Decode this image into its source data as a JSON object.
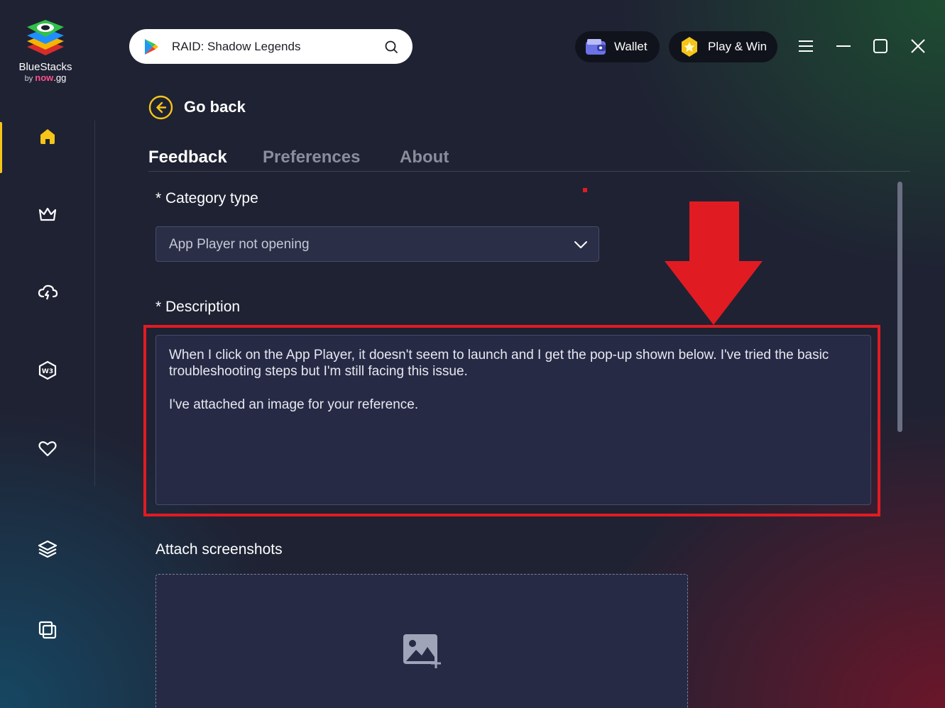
{
  "app": {
    "logo_name": "BlueStacks",
    "logo_by": "by",
    "logo_now": "now",
    "logo_gg": ".gg"
  },
  "search": {
    "value": "RAID: Shadow Legends",
    "icon": "search-icon",
    "store_icon": "google-play-icon"
  },
  "topbar": {
    "wallet_label": "Wallet",
    "playwin_label": "Play & Win"
  },
  "sidebar": {
    "items": [
      {
        "icon": "home-icon",
        "active": true
      },
      {
        "icon": "crown-icon"
      },
      {
        "icon": "cloud-icon"
      },
      {
        "icon": "w3-icon"
      },
      {
        "icon": "heart-icon"
      },
      {
        "icon": "layers-icon"
      },
      {
        "icon": "multi-instance-icon"
      }
    ]
  },
  "page": {
    "go_back": "Go back",
    "tabs": [
      {
        "label": "Feedback",
        "active": true
      },
      {
        "label": "Preferences"
      },
      {
        "label": "About"
      }
    ],
    "category_label": "* Category type",
    "category_value": "App Player not opening",
    "description_label": "* Description",
    "description_p1": "When I click on the App Player, it doesn't seem to launch and I get the pop-up shown below. I've tried the basic troubleshooting steps but I'm still facing this issue.",
    "description_p2": "I've attached an image for your reference.",
    "attach_label": "Attach screenshots"
  },
  "colors": {
    "accent": "#f5c518",
    "annotation_red": "#e11b22",
    "background": "#1f2233",
    "field_bg": "#262a45"
  }
}
